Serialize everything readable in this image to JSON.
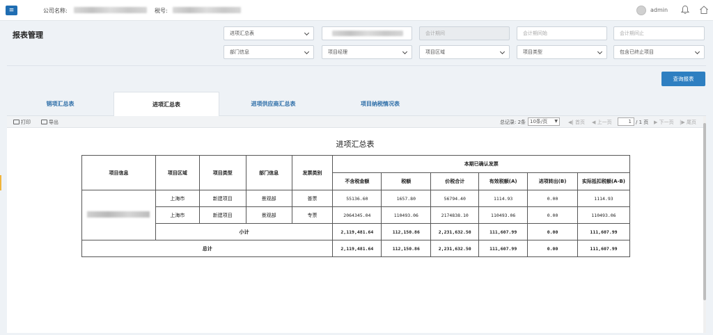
{
  "header": {
    "menu_icon": "hamburger-menu-icon",
    "company_label": "公司名称:",
    "tax_label": "税号:",
    "username": "admin"
  },
  "page": {
    "title": "报表管理"
  },
  "filters": {
    "report_type": "进项汇总表",
    "accounting_period": "会计期间",
    "period_start": "会计期间始",
    "period_end": "会计期间止",
    "department": "部门信息",
    "project_manager": "项目经理",
    "project_region": "项目区域",
    "project_type": "项目类型",
    "terminated": "包含已终止项目"
  },
  "query_button": "查询报表",
  "tabs": [
    {
      "label": "销项汇总表",
      "active": false
    },
    {
      "label": "进项汇总表",
      "active": true
    },
    {
      "label": "进项供应商汇总表",
      "active": false
    },
    {
      "label": "项目纳税情况表",
      "active": false
    }
  ],
  "toolbar": {
    "print": "打印",
    "export": "导出",
    "total_records": "总记录: 2条",
    "per_page": "10条/页",
    "first": "首页",
    "prev": "上一页",
    "current_page": "1",
    "total_pages": "/ 1 页",
    "next": "下一页",
    "last": "尾页"
  },
  "report": {
    "title": "进项汇总表",
    "headers": {
      "project_info": "项目信息",
      "region": "项目区域",
      "type": "项目类型",
      "dept": "部门信息",
      "invoice_type": "发票类别",
      "group": "本期已确认发票",
      "excl_tax": "不含税金额",
      "tax": "税额",
      "total": "价税合计",
      "valid_tax": "有效税额(A)",
      "transfer_out": "进项转出(B)",
      "deductible": "实际抵扣税额(A-B)"
    },
    "rows": [
      {
        "region": "上海市",
        "type": "新建项目",
        "dept": "景观部",
        "invoice_type": "普票",
        "excl_tax": "55136.60",
        "tax": "1657.80",
        "total": "56794.40",
        "valid_tax": "1114.93",
        "transfer_out": "0.00",
        "deductible": "1114.93"
      },
      {
        "region": "上海市",
        "type": "新建项目",
        "dept": "景观部",
        "invoice_type": "专票",
        "excl_tax": "2064345.04",
        "tax": "110493.06",
        "total": "2174838.10",
        "valid_tax": "110493.06",
        "transfer_out": "0.00",
        "deductible": "110493.06"
      }
    ],
    "subtotal": {
      "label": "小计",
      "excl_tax": "2,119,481.64",
      "tax": "112,150.86",
      "total": "2,231,632.50",
      "valid_tax": "111,607.99",
      "transfer_out": "0.00",
      "deductible": "111,607.99"
    },
    "grand_total": {
      "label": "总计",
      "excl_tax": "2,119,481.64",
      "tax": "112,150.86",
      "total": "2,231,632.50",
      "valid_tax": "111,607.99",
      "transfer_out": "0.00",
      "deductible": "111,607.99"
    }
  },
  "colors": {
    "primary": "#2e7fc1",
    "tab_link": "#2d6ea8",
    "background": "#eef2f6"
  }
}
